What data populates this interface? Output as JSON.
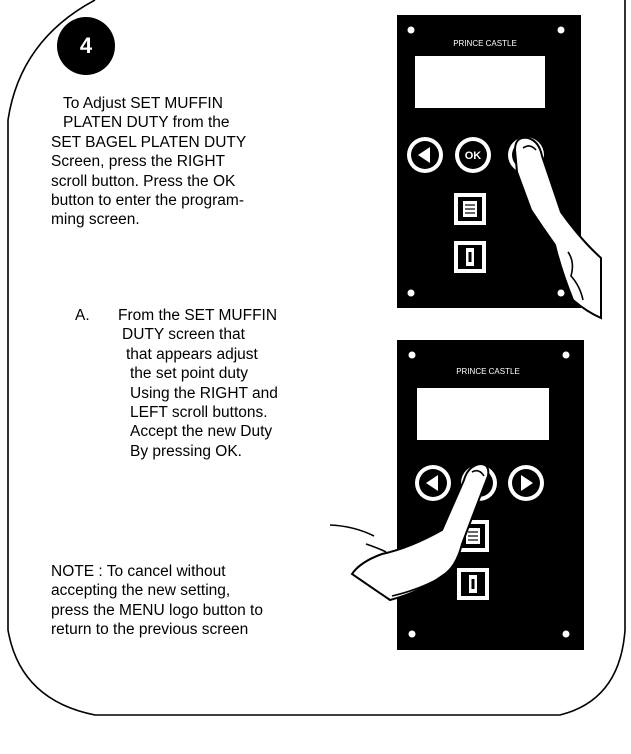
{
  "step": {
    "number": "4"
  },
  "intro": {
    "lines": [
      "To Adjust SET MUFFIN",
      "PLATEN DUTY from the",
      "SET BAGEL PLATEN DUTY",
      "Screen, press the RIGHT",
      "scroll button. Press the OK",
      "button to enter the program-",
      "ming screen."
    ]
  },
  "substep": {
    "letter": "A.",
    "lines": [
      "From the SET MUFFIN",
      " DUTY screen that",
      "  that appears adjust",
      "   the set point duty",
      "   Using the RIGHT and",
      "   LEFT scroll buttons.",
      "   Accept the new Duty",
      "   By pressing OK."
    ]
  },
  "note": {
    "lines": [
      "NOTE : To cancel without",
      "accepting the new setting,",
      "press the MENU logo button to",
      "return to the previous screen"
    ]
  },
  "panel_top": {
    "brand": "PRINCE CASTLE",
    "ok_label": "OK",
    "pressed": "right-button"
  },
  "panel_bottom": {
    "brand": "PRINCE CASTLE",
    "pressed": "ok-button"
  }
}
